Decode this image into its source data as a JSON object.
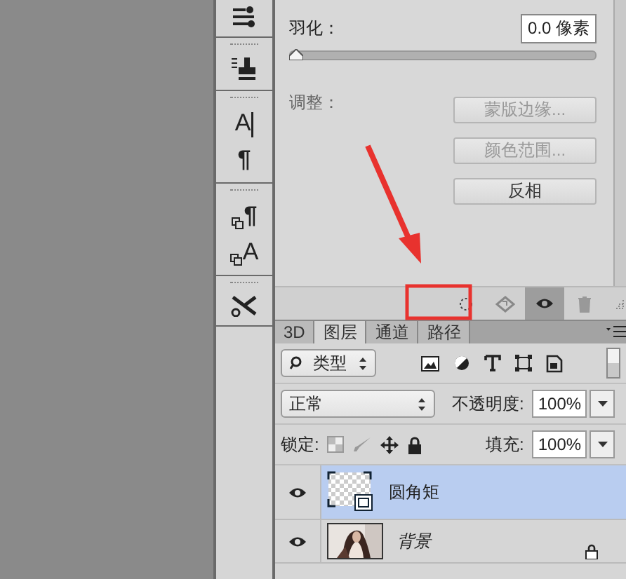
{
  "toolbar": {
    "glyphs": [
      "A",
      "¶",
      "¶",
      "A"
    ]
  },
  "properties": {
    "feather": {
      "label": "羽化：",
      "value": "0.0 像素",
      "level": 0
    },
    "adjust_label": "调整：",
    "buttons": [
      {
        "label": "蒙版边缘...",
        "disabled": true
      },
      {
        "label": "颜色范围...",
        "disabled": true
      },
      {
        "label": "反相",
        "disabled": false
      }
    ]
  },
  "panel_actions": [
    {
      "kind": "selection",
      "selected": false
    },
    {
      "kind": "apply",
      "selected": false
    },
    {
      "kind": "eye",
      "selected": true
    },
    {
      "kind": "trash",
      "selected": false
    }
  ],
  "layers_panel": {
    "tabs": [
      {
        "label": "3D",
        "selected": false
      },
      {
        "label": "图层",
        "selected": true
      },
      {
        "label": "通道",
        "selected": false
      },
      {
        "label": "路径",
        "selected": false
      }
    ],
    "filter": {
      "label": "类型",
      "on": true
    },
    "blend_mode": "正常",
    "opacity": {
      "label": "不透明度:",
      "value": "100%"
    },
    "lock_label": "锁定:",
    "fill": {
      "label": "填充:",
      "value": "100%"
    },
    "layers": [
      {
        "name": "圆角矩",
        "kind": "shape",
        "selected": true,
        "visible": true,
        "locked": false
      },
      {
        "name": "背景",
        "selected": false,
        "visible": true,
        "locked": true
      }
    ]
  }
}
